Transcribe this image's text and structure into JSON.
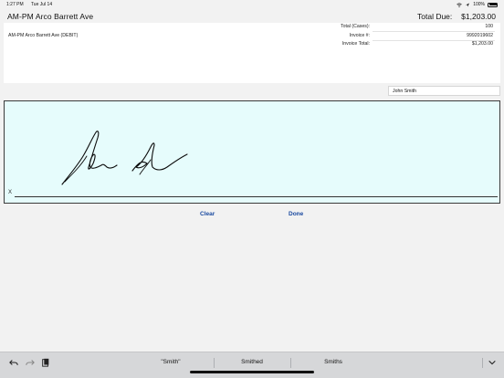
{
  "status_bar": {
    "time": "1:27 PM",
    "date": "Tue Jul 14",
    "battery": "100%"
  },
  "header": {
    "customer_name": "AM-PM Arco   Barrett Ave",
    "total_due_label": "Total Due:",
    "total_due_value": "$1,203.00"
  },
  "summary": {
    "customer_line": "AM-PM Arco   Barrett Ave  (DEBIT)",
    "rows": [
      {
        "label": "Total (Cases):",
        "value": "100"
      },
      {
        "label": "Invoice #:",
        "value": "9992019602"
      },
      {
        "label": "Invoice Total:",
        "value": "$1,203.00"
      }
    ]
  },
  "signer_name": {
    "value": "John Smith"
  },
  "signature": {
    "x_marker": "X"
  },
  "actions": {
    "clear_label": "Clear",
    "done_label": "Done"
  },
  "keyboard": {
    "suggestions": [
      "\"Smith\"",
      "Smithed",
      "Smiths"
    ],
    "icons": [
      "undo-icon",
      "redo-icon",
      "clipboard-icon",
      "chevron-down-icon"
    ]
  }
}
